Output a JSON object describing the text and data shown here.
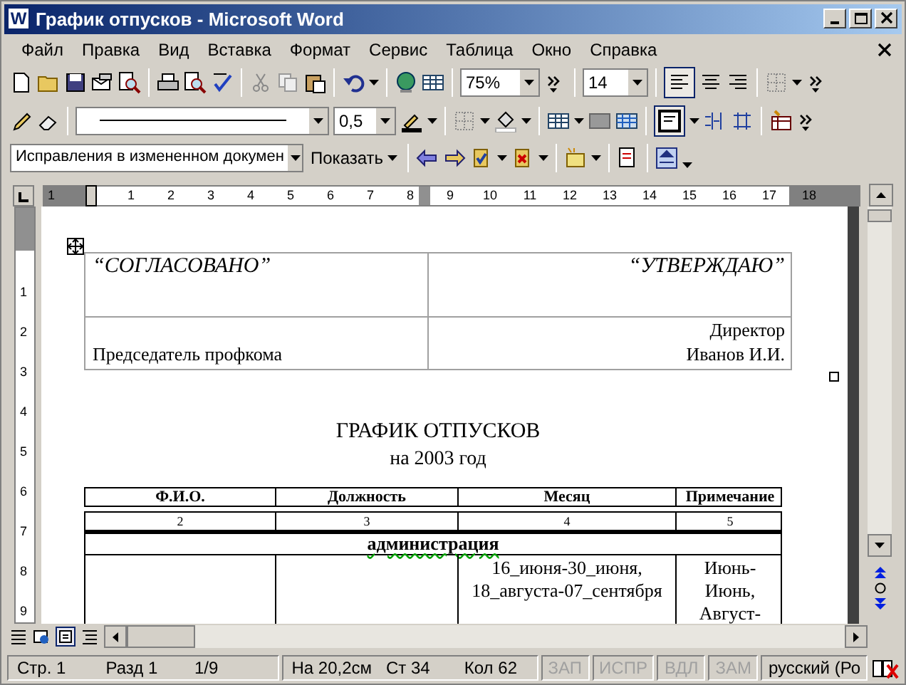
{
  "window": {
    "title": "График отпусков - Microsoft Word",
    "app_icon_letter": "W"
  },
  "menu": {
    "items": [
      "Файл",
      "Правка",
      "Вид",
      "Вставка",
      "Формат",
      "Сервис",
      "Таблица",
      "Окно",
      "Справка"
    ]
  },
  "toolbars": {
    "zoom": "75%",
    "font_size": "14",
    "line_weight": "0,5",
    "review_view": "Исправления в измененном докумен",
    "show_button": "Показать"
  },
  "ruler": {
    "horizontal": [
      "1",
      "1",
      "2",
      "3",
      "4",
      "5",
      "6",
      "7",
      "8",
      "9",
      "10",
      "11",
      "12",
      "13",
      "14",
      "15",
      "16",
      "17",
      "18"
    ],
    "vertical": [
      "1",
      "2",
      "3",
      "4",
      "5",
      "6",
      "7",
      "8",
      "9"
    ]
  },
  "approval_table": {
    "rows": [
      [
        [
          "“СОГЛАСОВАНО”"
        ],
        [
          "“УТВЕРЖДАЮ”"
        ]
      ],
      [
        [
          "Председатель профкома"
        ],
        [
          "Директор",
          "Иванов И.И."
        ]
      ]
    ]
  },
  "heading": "ГРАФИК ОТПУСКОВ",
  "subheading": "на 2003 год",
  "schedule_table": {
    "columns": [
      "Ф.И.О.",
      "Должность",
      "Месяц",
      "Примечание"
    ],
    "column_numbers": [
      "2",
      "3",
      "4",
      "5"
    ],
    "group_row": "администрация",
    "rows": [
      [
        [],
        [],
        [
          "16_июня-30_июня,",
          "18_августа-07_сентября"
        ],
        [
          "Июнь-",
          "Июнь,",
          "Август-"
        ]
      ]
    ]
  },
  "status_bar": {
    "items": [
      {
        "text": "Стр. 1",
        "disabled": false
      },
      {
        "text": "Разд 1",
        "disabled": false
      },
      {
        "text": "1/9",
        "disabled": false
      },
      {
        "text": "На 20,2см",
        "disabled": false
      },
      {
        "text": "Ст 34",
        "disabled": false
      },
      {
        "text": "Кол 62",
        "disabled": false
      },
      {
        "text": "ЗАП",
        "disabled": true
      },
      {
        "text": "ИСПР",
        "disabled": true
      },
      {
        "text": "ВДЛ",
        "disabled": true
      },
      {
        "text": "ЗАМ",
        "disabled": true
      },
      {
        "text": "русский (Ро",
        "disabled": false
      }
    ]
  }
}
